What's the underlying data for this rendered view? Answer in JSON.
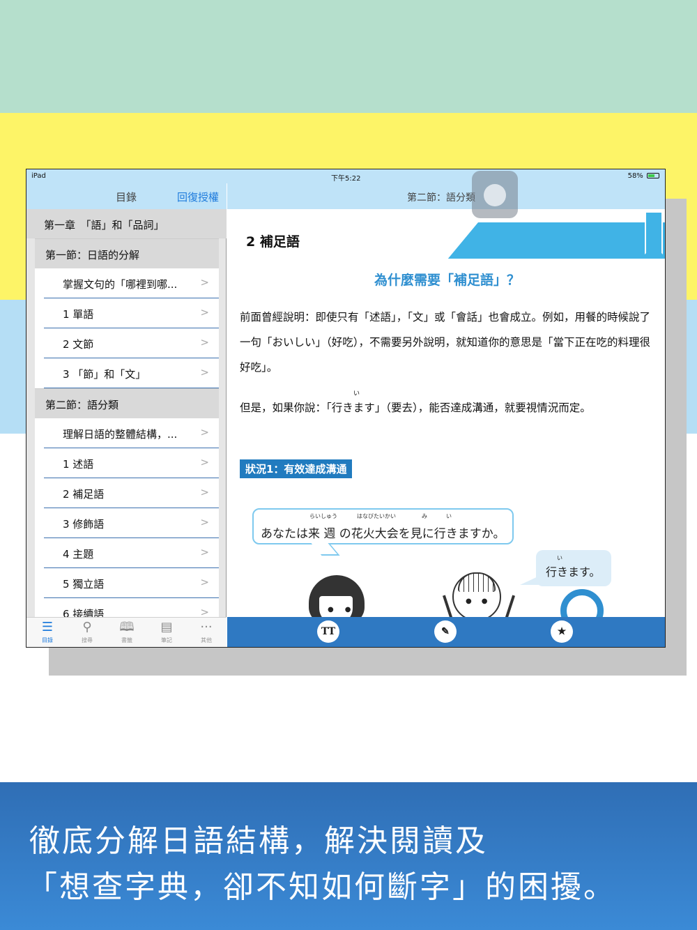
{
  "status_bar": {
    "device": "iPad",
    "time": "下午5:22",
    "battery": "58%"
  },
  "left_nav": {
    "title": "目錄",
    "restore_label": "回復授權"
  },
  "toc": {
    "chapter": "第一章　「語」和「品詞」",
    "entries": [
      {
        "kind": "section",
        "label": "第一節：日語的分解"
      },
      {
        "kind": "item",
        "label": "掌握文句的「哪裡到哪..."
      },
      {
        "kind": "item",
        "label": "1 單語"
      },
      {
        "kind": "item",
        "label": "2 文節"
      },
      {
        "kind": "item",
        "label": "3 「節」和「文」"
      },
      {
        "kind": "section",
        "label": "第二節：語分類"
      },
      {
        "kind": "item",
        "label": "理解日語的整體結構，..."
      },
      {
        "kind": "item",
        "label": "1 述語"
      },
      {
        "kind": "item",
        "label": "2 補足語"
      },
      {
        "kind": "item",
        "label": "3 修飾語"
      },
      {
        "kind": "item",
        "label": "4 主題"
      },
      {
        "kind": "item",
        "label": "5 獨立語"
      },
      {
        "kind": "item",
        "label": "6 接續語"
      }
    ]
  },
  "tabbar": {
    "tabs": [
      {
        "label": "目錄",
        "icon": "list-icon"
      },
      {
        "label": "搜尋",
        "icon": "search-icon"
      },
      {
        "label": "書籤",
        "icon": "book-icon"
      },
      {
        "label": "筆記",
        "icon": "notes-icon"
      },
      {
        "label": "其他",
        "icon": "more-icon"
      }
    ]
  },
  "right_nav": {
    "title": "第二節：語分類"
  },
  "lesson": {
    "banner": "2 補足語",
    "heading": "為什麼需要「補足語」？",
    "para1": "前面曾經說明：即使只有「述語」，「文」或「會話」也會成立。例如，用餐的時候說了一句「おいしい」（好吃），不需要另外說明，就知道你的意思是「當下正在吃的料理很好吃」。",
    "para2_ruby": "い",
    "para2": "但是，如果你說：「行きます」（要去），能否達成溝通，就要視情況而定。",
    "case_label": "狀況1：有效達成溝通",
    "bubble1": "あなたは来 週 の花火大会を見に行きますか。",
    "bubble1_furigana": [
      "らいしゅう",
      "はなびたいかい",
      "み",
      "い"
    ],
    "bubble2": "行きます。",
    "bubble2_furigana": "い"
  },
  "toolbar": {
    "font_button": "TT",
    "pen_button": "✎",
    "bookmark_button": "★"
  },
  "caption": {
    "line1": "徹底分解日語結構，解決閱讀及",
    "line2": "「想查字典，卻不知如何斷字」的困擾。"
  },
  "colors": {
    "accent": "#1e7bdc",
    "banner": "#40b3e6",
    "toolbar": "#2f79c2",
    "caption_bg": "#3b7ec6"
  }
}
